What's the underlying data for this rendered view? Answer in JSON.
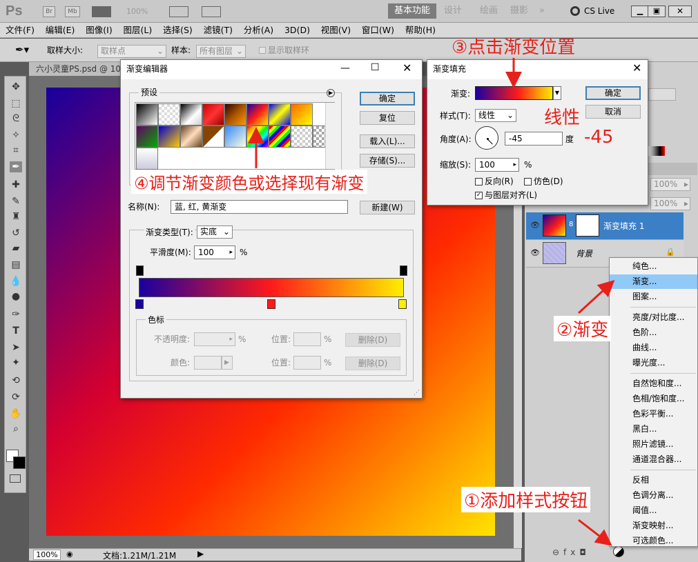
{
  "app": {
    "logo": "Ps",
    "bridge": "Br",
    "minibridge": "Mb",
    "zoom_top": "100%",
    "workspaces": [
      "基本功能",
      "设计",
      "绘画",
      "摄影"
    ],
    "more": "»",
    "cslive": "CS Live"
  },
  "menu": [
    "文件(F)",
    "编辑(E)",
    "图像(I)",
    "图层(L)",
    "选择(S)",
    "滤镜(T)",
    "分析(A)",
    "3D(D)",
    "视图(V)",
    "窗口(W)",
    "帮助(H)"
  ],
  "options": {
    "sample_size_label": "取样大小:",
    "sample_size_value": "取样点",
    "sample_label": "样本:",
    "sample_value": "所有图层",
    "show_ring": "显示取样环"
  },
  "document": {
    "tab": "六小灵童PS.psd @ 100",
    "zoom": "100%",
    "docsize": "文档:1.21M/1.21M"
  },
  "gradient_editor": {
    "title": "渐变编辑器",
    "presets_label": "预设",
    "ok": "确定",
    "reset": "复位",
    "load": "载入(L)...",
    "save": "存储(S)...",
    "name_label": "名称(N):",
    "name_value": "蓝, 红, 黄渐变",
    "new": "新建(W)",
    "type_label": "渐变类型(T):",
    "type_value": "实底",
    "smooth_label": "平滑度(M):",
    "smooth_value": "100",
    "percent": "%",
    "stops_label": "色标",
    "opacity_label": "不透明度:",
    "position_label": "位置:",
    "delete": "删除(D)",
    "color_label": "颜色:",
    "gradient_stops": [
      {
        "color": "#1a00a0",
        "position": 0
      },
      {
        "color": "#ff1a1a",
        "position": 50
      },
      {
        "color": "#ffee00",
        "position": 100
      }
    ]
  },
  "gradient_fill": {
    "title": "渐变填充",
    "gradient_label": "渐变:",
    "style_label": "样式(T):",
    "style_value": "线性",
    "angle_label": "角度(A):",
    "angle_value": "-45",
    "degree": "度",
    "scale_label": "缩放(S):",
    "scale_value": "100",
    "percent": "%",
    "reverse": "反向(R)",
    "dither": "仿色(D)",
    "align": "与图层对齐(L)",
    "ok": "确定",
    "cancel": "取消"
  },
  "layers": {
    "opacity": "100%",
    "fill": "100%",
    "items": [
      {
        "name": "渐变填充 1",
        "selected": true
      },
      {
        "name": "背景",
        "selected": false
      }
    ]
  },
  "context_menu": {
    "groups": [
      [
        "纯色...",
        "渐变...",
        "图案..."
      ],
      [
        "亮度/对比度...",
        "色阶...",
        "曲线...",
        "曝光度..."
      ],
      [
        "自然饱和度...",
        "色相/饱和度...",
        "色彩平衡...",
        "黑白...",
        "照片滤镜...",
        "通道混合器..."
      ],
      [
        "反相",
        "色调分离...",
        "阈值...",
        "渐变映射...",
        "可选颜色..."
      ]
    ],
    "highlighted": "渐变..."
  },
  "annotations": {
    "step1": "①添加样式按钮",
    "step2": "②渐变",
    "step3": "③点击渐变位置",
    "step4": "④调节渐变颜色或选择现有渐变",
    "linear": "线性",
    "angle": "-45"
  }
}
